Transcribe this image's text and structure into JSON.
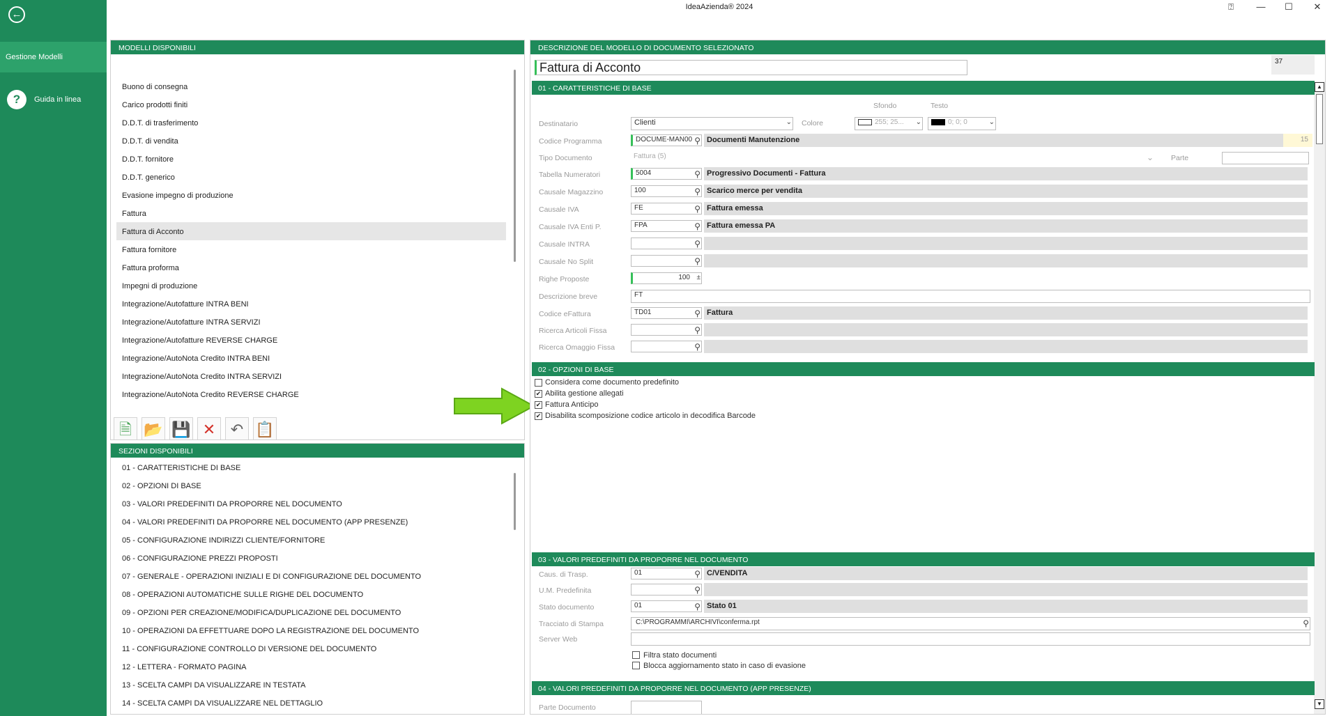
{
  "app": {
    "title": "IdeaAzienda® 2024"
  },
  "window": {
    "help": "⍰",
    "minimize": "—",
    "maximize": "☐",
    "close": "✕"
  },
  "sidebar": {
    "back_icon": "arrow-left-circle",
    "active_item": "Gestione Modelli",
    "help_label": "Guida in linea",
    "help_icon": "?"
  },
  "models_panel": {
    "header": "MODELLI DISPONIBILI",
    "items": [
      "Buono di consegna",
      "Carico prodotti finiti",
      "D.D.T. di trasferimento",
      "D.D.T. di vendita",
      "D.D.T. fornitore",
      "D.D.T. generico",
      "Evasione impegno di produzione",
      "Fattura",
      "Fattura di Acconto",
      "Fattura fornitore",
      "Fattura proforma",
      "Impegni di produzione",
      "Integrazione/Autofatture INTRA BENI",
      "Integrazione/Autofatture INTRA SERVIZI",
      "Integrazione/Autofatture REVERSE CHARGE",
      "Integrazione/AutoNota Credito INTRA BENI",
      "Integrazione/AutoNota Credito INTRA SERVIZI",
      "Integrazione/AutoNota Credito REVERSE CHARGE"
    ],
    "selected": "Fattura di Acconto"
  },
  "toolbar": {
    "icons": [
      "new-document-icon",
      "open-folder-icon",
      "save-icon",
      "delete-icon",
      "undo-icon",
      "copy-icon"
    ]
  },
  "sections_panel": {
    "header": "SEZIONI DISPONIBILI",
    "items": [
      "01 - CARATTERISTICHE DI BASE",
      "02 - OPZIONI DI BASE",
      "03 - VALORI PREDEFINITI DA PROPORRE NEL DOCUMENTO",
      "04 - VALORI PREDEFINITI DA PROPORRE NEL DOCUMENTO (APP PRESENZE)",
      "05 - CONFIGURAZIONE INDIRIZZI CLIENTE/FORNITORE",
      "06 - CONFIGURAZIONE PREZZI PROPOSTI",
      "07 - GENERALE - OPERAZIONI INIZIALI E DI CONFIGURAZIONE DEL DOCUMENTO",
      "08 - OPERAZIONI AUTOMATICHE SULLE RIGHE DEL DOCUMENTO",
      "09 - OPZIONI PER CREAZIONE/MODIFICA/DUPLICAZIONE DEL DOCUMENTO",
      "10 - OPERAZIONI DA EFFETTUARE DOPO LA REGISTRAZIONE DEL DOCUMENTO",
      "11 - CONFIGURAZIONE CONTROLLO DI VERSIONE DEL DOCUMENTO",
      "12 - LETTERA - FORMATO PAGINA",
      "13 - SCELTA CAMPI DA VISUALIZZARE IN TESTATA",
      "14 - SCELTA CAMPI DA VISUALIZZARE NEL DETTAGLIO"
    ]
  },
  "detail": {
    "header": "DESCRIZIONE DEL MODELLO DI DOCUMENTO SELEZIONATO",
    "name": "Fattura di Acconto",
    "id": "37",
    "section1": {
      "header": "01 - CARATTERISTICHE DI BASE",
      "col_sfondo": "Sfondo",
      "col_testo": "Testo",
      "destinatario_label": "Destinatario",
      "destinatario_value": "Clienti",
      "colore_label": "Colore",
      "sfondo_value": "255; 25...",
      "testo_value": "0; 0; 0",
      "codice_programma_label": "Codice Programma",
      "codice_programma_code": "DOCUME-MAN00",
      "codice_programma_desc": "Documenti Manutenzione",
      "codice_programma_len": "15",
      "tipo_documento_label": "Tipo Documento",
      "tipo_documento_value": "Fattura (5)",
      "parte_label": "Parte",
      "tabella_numeratori_label": "Tabella Numeratori",
      "tabella_numeratori_code": "5004",
      "tabella_numeratori_desc": "Progressivo Documenti - Fattura",
      "causale_magazzino_label": "Causale Magazzino",
      "causale_magazzino_code": "100",
      "causale_magazzino_desc": "Scarico merce per vendita",
      "causale_iva_label": "Causale IVA",
      "causale_iva_code": "FE",
      "causale_iva_desc": "Fattura emessa",
      "causale_iva_pa_label": "Causale IVA Enti P.",
      "causale_iva_pa_code": "FPA",
      "causale_iva_pa_desc": "Fattura emessa PA",
      "causale_intra_label": "Causale INTRA",
      "causale_nosplit_label": "Causale No Split",
      "righe_proposte_label": "Righe Proposte",
      "righe_proposte_value": "100",
      "descrizione_breve_label": "Descrizione breve",
      "descrizione_breve_value": "FT",
      "codice_efattura_label": "Codice eFattura",
      "codice_efattura_code": "TD01",
      "codice_efattura_desc": "Fattura",
      "ricerca_articoli_label": "Ricerca Articoli Fissa",
      "ricerca_omaggio_label": "Ricerca Omaggio Fissa"
    },
    "section2": {
      "header": "02 - OPZIONI DI BASE",
      "options": [
        {
          "label": "Considera come documento predefinito",
          "checked": false
        },
        {
          "label": "Abilita gestione allegati",
          "checked": true
        },
        {
          "label": "Fattura Anticipo",
          "checked": true
        },
        {
          "label": "Disabilita scomposizione codice articolo in decodifica Barcode",
          "checked": true
        }
      ]
    },
    "section3": {
      "header": "03 - VALORI PREDEFINITI DA PROPORRE NEL DOCUMENTO",
      "caus_trasp_label": "Caus. di Trasp.",
      "caus_trasp_code": "01",
      "caus_trasp_desc": "C/VENDITA",
      "um_label": "U.M. Predefinita",
      "stato_label": "Stato documento",
      "stato_code": "01",
      "stato_desc": "Stato 01",
      "tracciato_label": "Tracciato di Stampa",
      "tracciato_value": "C:\\PROGRAMMI\\ARCHIVI\\conferma.rpt",
      "server_web_label": "Server Web",
      "filtra_label": "Filtra stato documenti",
      "blocca_label": "Blocca aggiornamento stato in caso di evasione"
    },
    "section4": {
      "header": "04 - VALORI PREDEFINITI DA PROPORRE NEL DOCUMENTO (APP PRESENZE)",
      "parte_documento_label": "Parte Documento"
    }
  },
  "colors": {
    "brand": "#1e8a5a",
    "arrow": "#7ed321"
  }
}
